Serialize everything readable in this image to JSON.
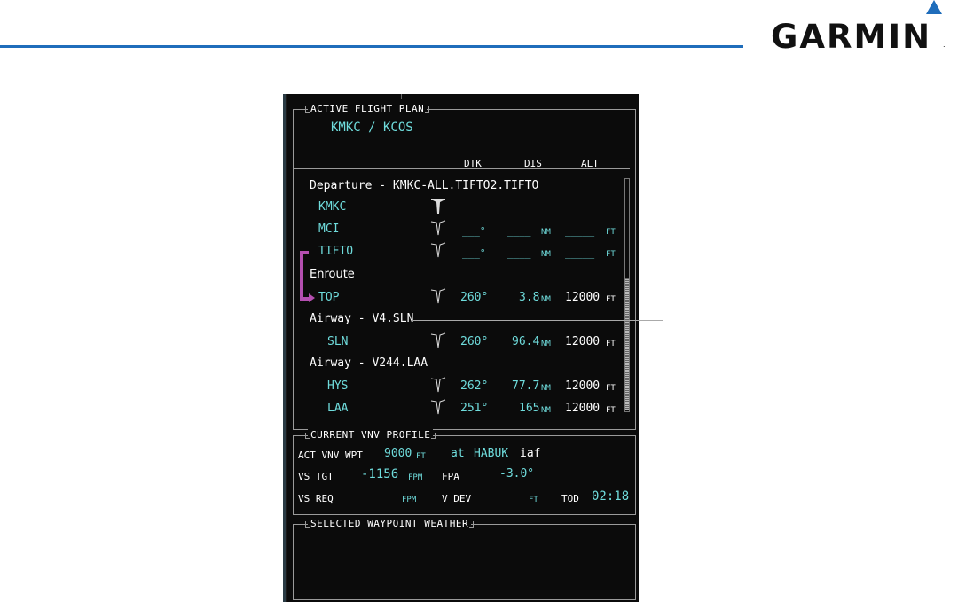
{
  "brand": {
    "name": "GARMIN",
    "reg": "."
  },
  "flight_plan": {
    "title": "ACTIVE FLIGHT PLAN",
    "route": "KMKC / KCOS",
    "headers": {
      "dtk": "DTK",
      "dis": "DIS",
      "alt": "ALT"
    },
    "departure_label": "Departure - KMKC-ALL.TIFTO2.TIFTO",
    "rows": [
      {
        "id": "KMKC",
        "dtk": "",
        "dis": "",
        "dis_unit": "",
        "alt": "",
        "alt_unit": ""
      },
      {
        "id": "MCI",
        "dtk": "___°",
        "dis": "____",
        "dis_unit": "NM",
        "alt": "_____",
        "alt_unit": "FT"
      },
      {
        "id": "TIFTO",
        "dtk": "___°",
        "dis": "____",
        "dis_unit": "NM",
        "alt": "_____",
        "alt_unit": "FT"
      }
    ],
    "enroute_label": "Enroute",
    "top": {
      "id": "TOP",
      "dtk": "260°",
      "dis": "3.8",
      "dis_unit": "NM",
      "alt": "12000",
      "alt_unit": "FT"
    },
    "airway1_label": "Airway - V4.SLN",
    "sln": {
      "id": "SLN",
      "dtk": "260°",
      "dis": "96.4",
      "dis_unit": "NM",
      "alt": "12000",
      "alt_unit": "FT"
    },
    "airway2_label": "Airway - V244.LAA",
    "hys": {
      "id": "HYS",
      "dtk": "262°",
      "dis": "77.7",
      "dis_unit": "NM",
      "alt": "12000",
      "alt_unit": "FT"
    },
    "laa": {
      "id": "LAA",
      "dtk": "251°",
      "dis": "165",
      "dis_unit": "NM",
      "alt": "12000",
      "alt_unit": "FT"
    }
  },
  "vnv": {
    "title": "CURRENT VNV PROFILE",
    "act_label": "ACT VNV WPT",
    "act_alt": "9000",
    "act_alt_unit": "FT",
    "at": "at",
    "act_wpt": "HABUK",
    "act_wpt_suffix": "iaf",
    "vs_tgt_label": "VS TGT",
    "vs_tgt": "-1156",
    "vs_tgt_unit": "FPM",
    "fpa_label": "FPA",
    "fpa": "-3.0°",
    "vs_req_label": "VS REQ",
    "vs_req": "_____",
    "vs_req_unit": "FPM",
    "vdev_label": "V DEV",
    "vdev": "_____",
    "vdev_unit": "FT",
    "tod_label": "TOD",
    "tod": "02:18"
  },
  "weather": {
    "title": "SELECTED WAYPOINT WEATHER"
  },
  "colors": {
    "cyan": "#6fdcdc",
    "magenta": "#b44fb0",
    "rule_blue": "#1f6dbb"
  }
}
